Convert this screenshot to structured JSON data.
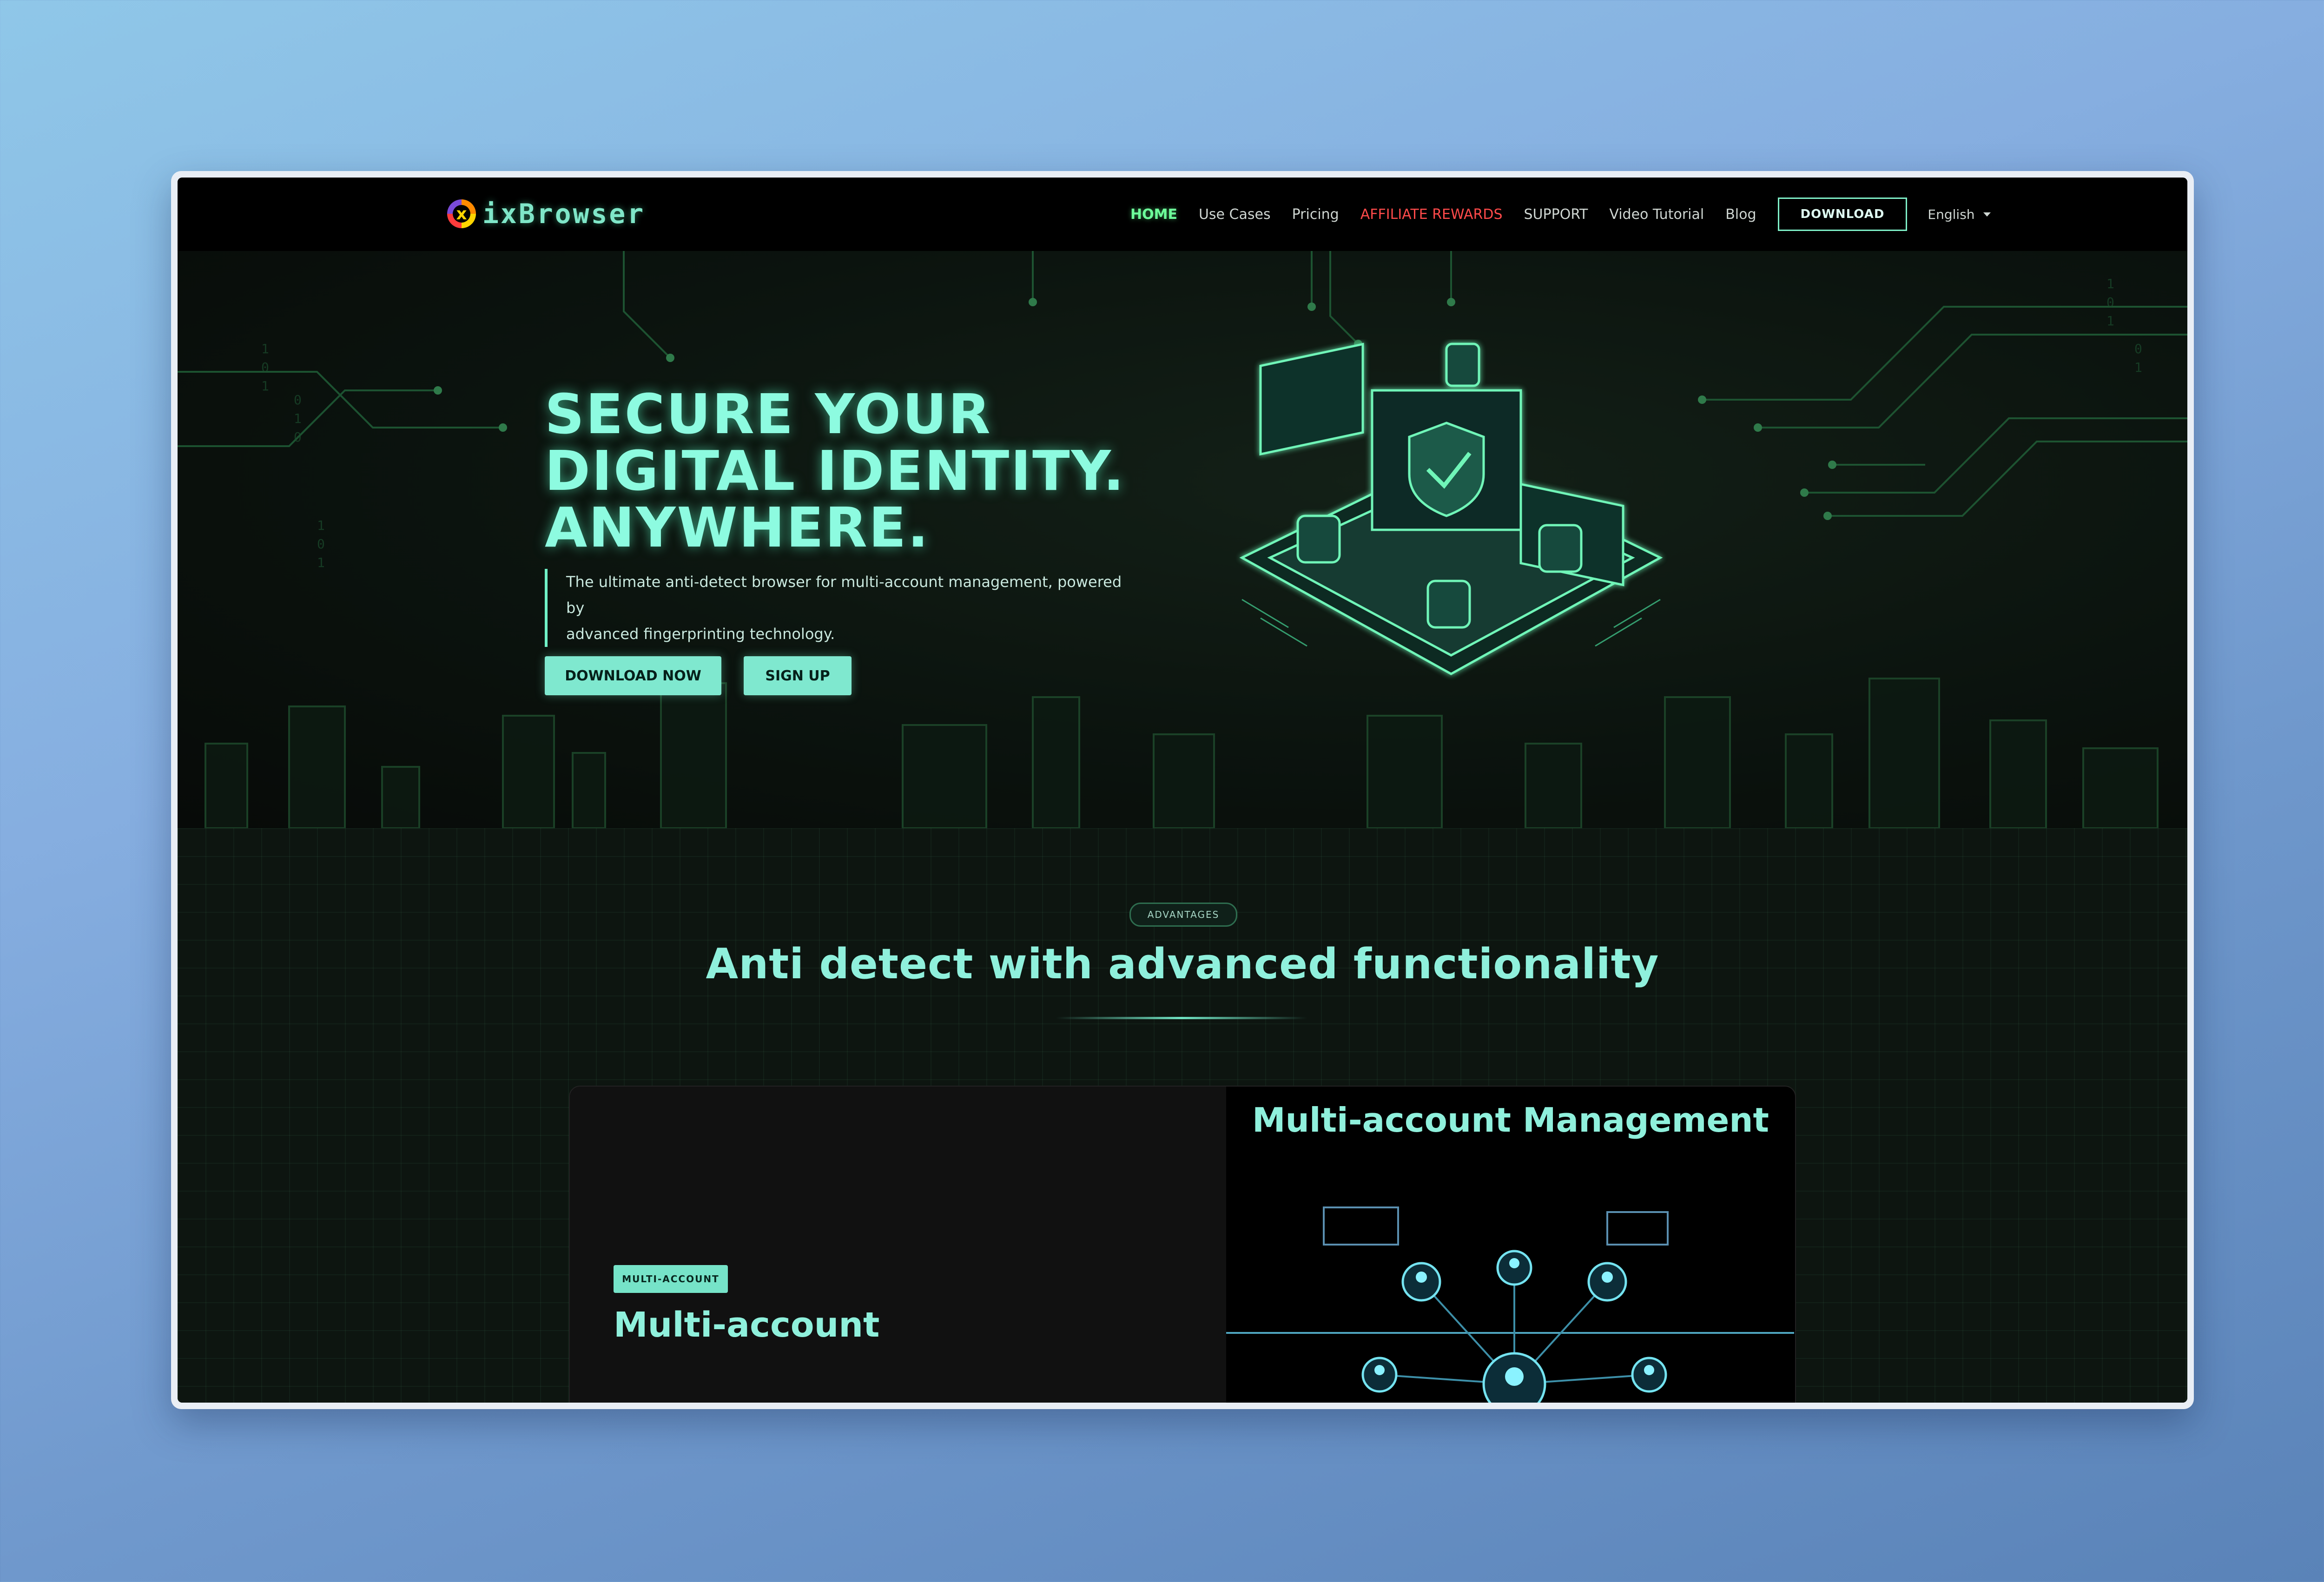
{
  "brand": {
    "name": "ixBrowser"
  },
  "nav": {
    "items": [
      "HOME",
      "Use Cases",
      "Pricing",
      "AFFILIATE REWARDS",
      "SUPPORT",
      "Video Tutorial",
      "Blog"
    ],
    "download_label": "DOWNLOAD",
    "language": "English"
  },
  "hero": {
    "title_line1": "SECURE YOUR",
    "title_line2": "DIGITAL IDENTITY.",
    "title_line3": "ANYWHERE.",
    "subtitle_line1": "The ultimate anti-detect browser for multi-account management, powered by",
    "subtitle_line2": "advanced fingerprinting technology.",
    "primary_button": "DOWNLOAD NOW",
    "secondary_button": "SIGN UP"
  },
  "advantages": {
    "badge": "ADVANTAGES",
    "title": "Anti detect with advanced functionality",
    "card": {
      "tag": "MULTI-ACCOUNT",
      "heading": "Multi-account",
      "right_title": "Multi-account Management"
    }
  },
  "colors": {
    "accent": "#8ff0dc",
    "active_nav": "#6dff9a",
    "affiliate": "#ff4a4a",
    "button_bg": "#7fe8cf"
  },
  "icons": [
    "logo-icon",
    "shield-icon",
    "lock-icon",
    "star-icon",
    "home-icon",
    "chevron-down-icon",
    "translate-icon",
    "mail-icon",
    "avatar"
  ]
}
